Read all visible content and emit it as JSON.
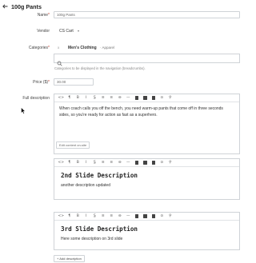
{
  "header": {
    "back_icon": "arrow-left-icon",
    "title": "100g Pants"
  },
  "form": {
    "name": {
      "label": "Name",
      "value": "100g Pants"
    },
    "vendor": {
      "label": "Vendor",
      "value": "CS Cart",
      "chevron": "▾"
    },
    "categories": {
      "label": "Categories",
      "remove": "x",
      "selected_name": "Men's Clothing",
      "selected_path": "· Apparel",
      "help": "Categories to be displayed in the navigation (breadcrumbs)."
    },
    "price": {
      "label": "Price ($)",
      "value": "30.00"
    },
    "full_description": {
      "label": "Full description"
    },
    "required_mark": "*"
  },
  "toolbar_glyphs": [
    "<>",
    "¶",
    "B",
    "I",
    "S̲",
    "≡",
    "≡",
    "⊖",
    "—",
    "▪",
    "▪",
    "▪",
    "⊙",
    "⚲"
  ],
  "editors": {
    "main": {
      "text_line1": "When coach calls you off the bench, you need warm-up pants that come off in three seconds",
      "text_line2": "sides, so you're ready for action as fast as a superhero.",
      "edit_button": "Edit content on-site"
    },
    "slide2": {
      "title": "2nd Slide Description",
      "body": "another description updated"
    },
    "slide3": {
      "title": "3rd Slide Description",
      "body": "Here some description on 3rd slide"
    }
  },
  "add_description_button": "+ Add description"
}
